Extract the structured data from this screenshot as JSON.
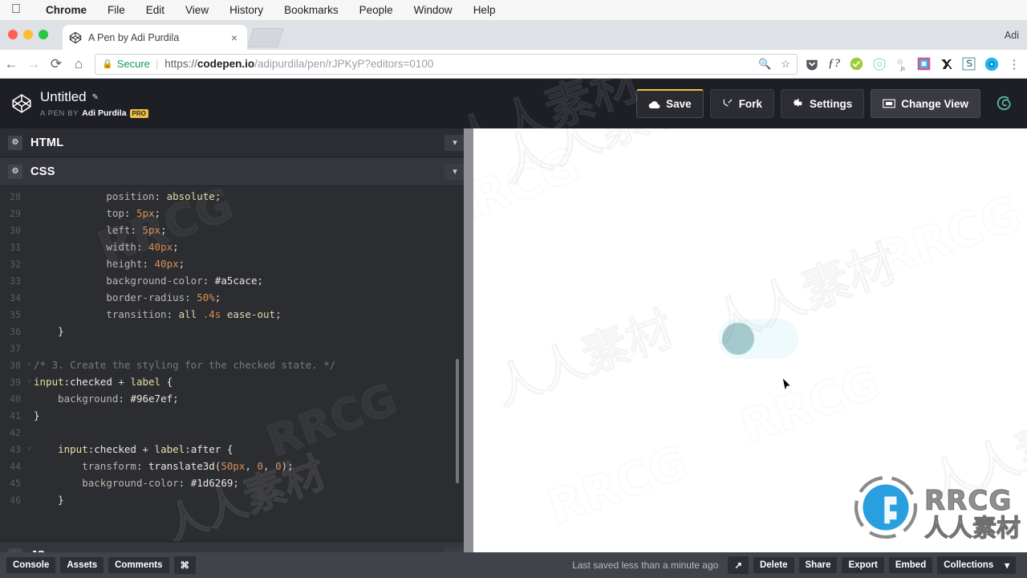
{
  "os_menubar": {
    "apple_icon": "apple-logo",
    "items": [
      "Chrome",
      "File",
      "Edit",
      "View",
      "History",
      "Bookmarks",
      "People",
      "Window",
      "Help"
    ]
  },
  "browser": {
    "tab": {
      "title": "A Pen by Adi Purdila",
      "favicon": "codepen-icon",
      "close": "×"
    },
    "profile": "Adi",
    "toolbar": {
      "back": "←",
      "forward": "→",
      "reload": "⟳",
      "home": "⌂",
      "secure_label": "Secure",
      "url_scheme": "https://",
      "url_host": "codepen.io",
      "url_path": "/adipurdila/pen/rJPKyP?editors=0100",
      "zoom_icon": "zoom-out-icon",
      "bookmark_icon": "star-icon",
      "menu_icon": "kebab-menu-icon",
      "extensions": [
        "pocket-icon",
        "font-inspector-icon",
        "check-shield-icon",
        "privacy-badger-icon",
        "js-toggle-icon",
        "colorzilla-icon",
        "wappalyzer-icon",
        "stylish-icon",
        "eye-dropper-icon"
      ]
    }
  },
  "codepen_header": {
    "logo": "codepen-logo",
    "pen_title": "Untitled",
    "edit_icon": "pencil-icon",
    "by_prefix": "A PEN BY",
    "author": "Adi Purdila",
    "pro_badge": "PRO",
    "buttons": [
      {
        "label": "Save",
        "icon": "cloud-icon",
        "name": "save-button"
      },
      {
        "label": "Fork",
        "icon": "fork-icon",
        "name": "fork-button"
      },
      {
        "label": "Settings",
        "icon": "gear-icon",
        "name": "settings-button"
      },
      {
        "label": "Change View",
        "icon": "layout-icon",
        "name": "change-view-button"
      }
    ],
    "spiral_icon": "spiral-icon",
    "accent_color": "#f0c040"
  },
  "editor": {
    "panels": [
      {
        "label": "HTML",
        "gear_icon": "gear-icon",
        "chevron": "chevron-down-icon"
      },
      {
        "label": "CSS",
        "gear_icon": "gear-icon",
        "chevron": "chevron-down-icon"
      },
      {
        "label": "JS",
        "gear_icon": "gear-icon",
        "chevron": "chevron-down-icon"
      }
    ],
    "code_lines": [
      {
        "num": "28",
        "fold": "",
        "indent": 3,
        "tokens": [
          {
            "t": "position",
            "c": "prop"
          },
          {
            "t": ": ",
            "c": "punct"
          },
          {
            "t": "absolute",
            "c": "kw"
          },
          {
            "t": ";",
            "c": "punct"
          }
        ]
      },
      {
        "num": "29",
        "fold": "",
        "indent": 3,
        "tokens": [
          {
            "t": "top",
            "c": "prop"
          },
          {
            "t": ": ",
            "c": "punct"
          },
          {
            "t": "5px",
            "c": "num"
          },
          {
            "t": ";",
            "c": "punct"
          }
        ]
      },
      {
        "num": "30",
        "fold": "",
        "indent": 3,
        "tokens": [
          {
            "t": "left",
            "c": "prop"
          },
          {
            "t": ": ",
            "c": "punct"
          },
          {
            "t": "5px",
            "c": "num"
          },
          {
            "t": ";",
            "c": "punct"
          }
        ]
      },
      {
        "num": "31",
        "fold": "",
        "indent": 3,
        "tokens": [
          {
            "t": "width",
            "c": "prop"
          },
          {
            "t": ": ",
            "c": "punct"
          },
          {
            "t": "40px",
            "c": "num"
          },
          {
            "t": ";",
            "c": "punct"
          }
        ]
      },
      {
        "num": "32",
        "fold": "",
        "indent": 3,
        "tokens": [
          {
            "t": "height",
            "c": "prop"
          },
          {
            "t": ": ",
            "c": "punct"
          },
          {
            "t": "40px",
            "c": "num"
          },
          {
            "t": ";",
            "c": "punct"
          }
        ]
      },
      {
        "num": "33",
        "fold": "",
        "indent": 3,
        "tokens": [
          {
            "t": "background-color",
            "c": "prop"
          },
          {
            "t": ": ",
            "c": "punct"
          },
          {
            "t": "#a5cace",
            "c": "hex"
          },
          {
            "t": ";",
            "c": "punct"
          }
        ]
      },
      {
        "num": "34",
        "fold": "",
        "indent": 3,
        "tokens": [
          {
            "t": "border-radius",
            "c": "prop"
          },
          {
            "t": ": ",
            "c": "punct"
          },
          {
            "t": "50%",
            "c": "num"
          },
          {
            "t": ";",
            "c": "punct"
          }
        ]
      },
      {
        "num": "35",
        "fold": "",
        "indent": 3,
        "tokens": [
          {
            "t": "transition",
            "c": "prop"
          },
          {
            "t": ": ",
            "c": "punct"
          },
          {
            "t": "all",
            "c": "kw"
          },
          {
            "t": " ",
            "c": "punct"
          },
          {
            "t": ".4s",
            "c": "num"
          },
          {
            "t": " ",
            "c": "punct"
          },
          {
            "t": "ease-out",
            "c": "kw"
          },
          {
            "t": ";",
            "c": "punct"
          }
        ]
      },
      {
        "num": "36",
        "fold": "",
        "indent": 1,
        "tokens": [
          {
            "t": "}",
            "c": "plain"
          }
        ]
      },
      {
        "num": "37",
        "fold": "",
        "indent": 0,
        "tokens": []
      },
      {
        "num": "38",
        "fold": "˅",
        "indent": 0,
        "tokens": [
          {
            "t": "/* 3. Create the styling for the checked state. */",
            "c": "comment"
          }
        ]
      },
      {
        "num": "39",
        "fold": "˅",
        "indent": 0,
        "tokens": [
          {
            "t": "input",
            "c": "sel"
          },
          {
            "t": ":checked",
            "c": "plain"
          },
          {
            "t": " + ",
            "c": "punct"
          },
          {
            "t": "label",
            "c": "sel"
          },
          {
            "t": " {",
            "c": "plain"
          }
        ]
      },
      {
        "num": "40",
        "fold": "",
        "indent": 1,
        "tokens": [
          {
            "t": "background",
            "c": "prop"
          },
          {
            "t": ": ",
            "c": "punct"
          },
          {
            "t": "#96e7ef",
            "c": "hex"
          },
          {
            "t": ";",
            "c": "punct"
          }
        ]
      },
      {
        "num": "41",
        "fold": "",
        "indent": 0,
        "tokens": [
          {
            "t": "}",
            "c": "plain"
          }
        ]
      },
      {
        "num": "42",
        "fold": "",
        "indent": 0,
        "tokens": []
      },
      {
        "num": "43",
        "fold": "˅",
        "indent": 1,
        "tokens": [
          {
            "t": "input",
            "c": "sel"
          },
          {
            "t": ":checked",
            "c": "plain"
          },
          {
            "t": " + ",
            "c": "punct"
          },
          {
            "t": "label",
            "c": "sel"
          },
          {
            "t": ":after",
            "c": "plain"
          },
          {
            "t": " {",
            "c": "plain"
          }
        ]
      },
      {
        "num": "44",
        "fold": "",
        "indent": 2,
        "tokens": [
          {
            "t": "transform",
            "c": "prop"
          },
          {
            "t": ": ",
            "c": "punct"
          },
          {
            "t": "translate3d",
            "c": "plain"
          },
          {
            "t": "(",
            "c": "punct"
          },
          {
            "t": "50px",
            "c": "num"
          },
          {
            "t": ", ",
            "c": "punct"
          },
          {
            "t": "0",
            "c": "num"
          },
          {
            "t": ", ",
            "c": "punct"
          },
          {
            "t": "0",
            "c": "num"
          },
          {
            "t": ");",
            "c": "punct"
          }
        ]
      },
      {
        "num": "45",
        "fold": "",
        "indent": 2,
        "tokens": [
          {
            "t": "background-color",
            "c": "prop"
          },
          {
            "t": ": ",
            "c": "punct"
          },
          {
            "t": "#1d6269",
            "c": "hex"
          },
          {
            "t": ";",
            "c": "punct"
          }
        ]
      },
      {
        "num": "46",
        "fold": "",
        "indent": 1,
        "tokens": [
          {
            "t": "}",
            "c": "plain"
          }
        ]
      }
    ]
  },
  "preview": {
    "toggle_track_color": "#eefafb",
    "toggle_knob_color": "#a5cace",
    "cursor_icon": "mouse-pointer-icon"
  },
  "bottombar": {
    "left_buttons": [
      "Console",
      "Assets",
      "Comments",
      "⌘"
    ],
    "saved_text": "Last saved less than a minute ago",
    "popout_icon": "external-link-icon",
    "right_buttons": [
      "Delete",
      "Share",
      "Export",
      "Embed",
      "Collections"
    ],
    "collections_chevron": "▾"
  },
  "watermark": {
    "text_latin": "RRCG",
    "text_cjk": "人人素材",
    "logo_latin": "RRCG",
    "logo_cjk": "人人素材",
    "logo_color": "#2a9fe0"
  }
}
